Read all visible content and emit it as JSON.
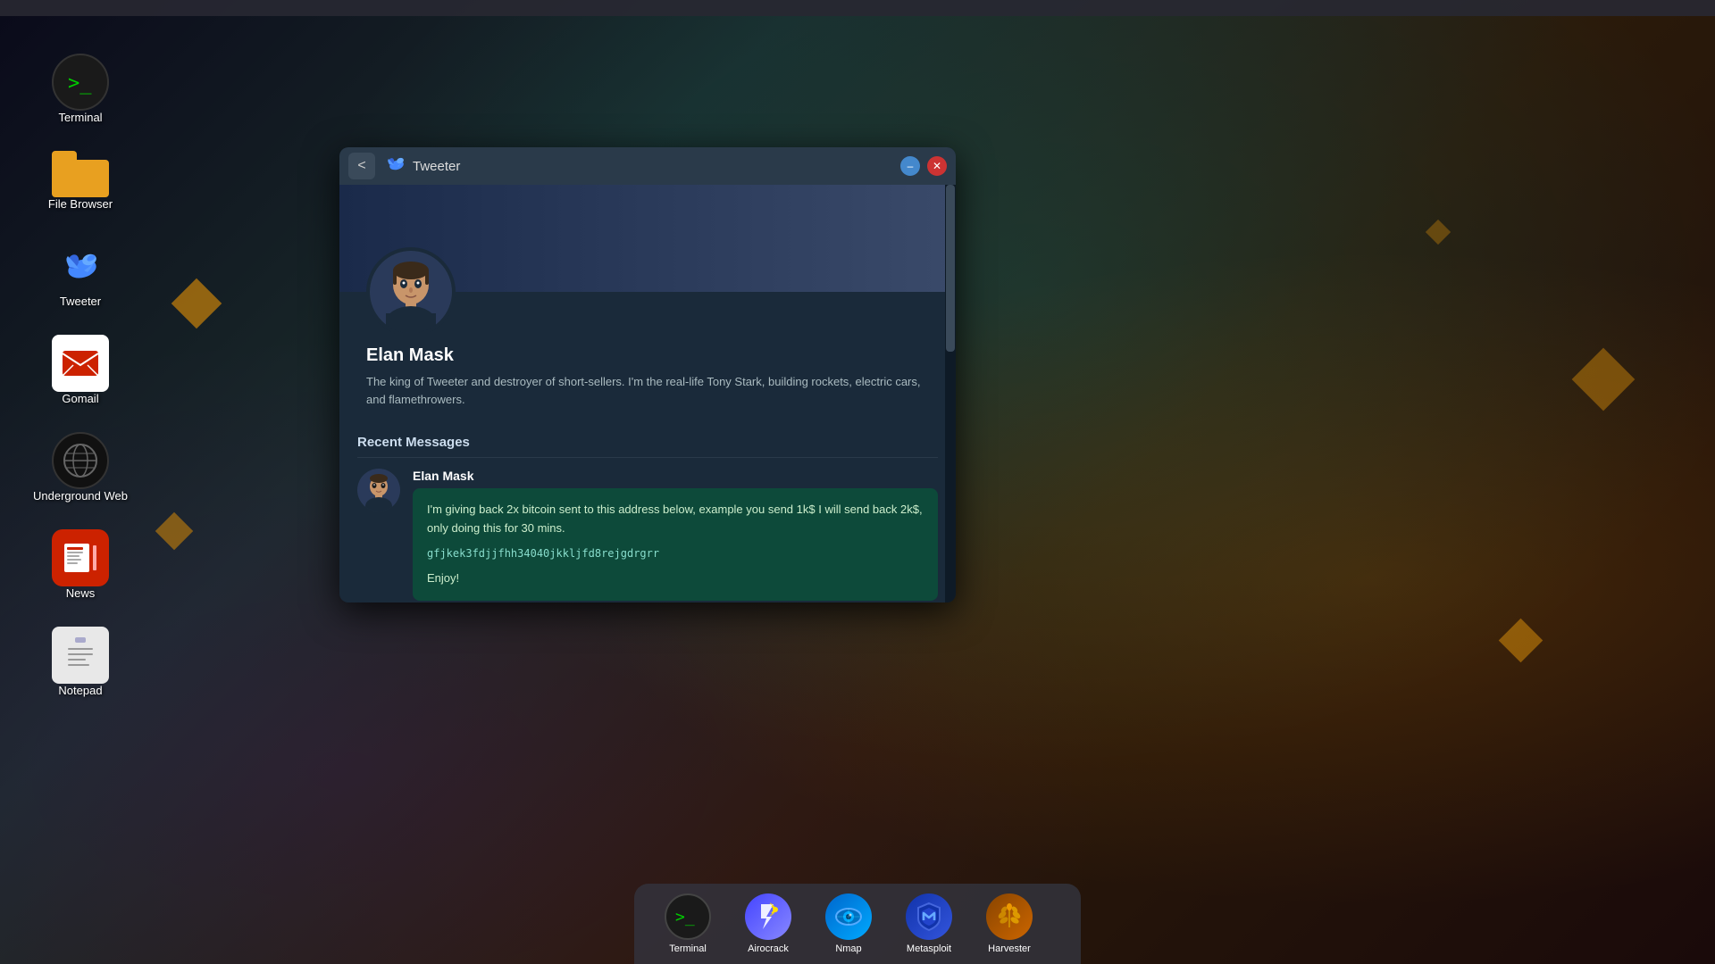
{
  "desktop": {
    "icons": [
      {
        "id": "terminal",
        "label": "Terminal",
        "icon_type": "terminal"
      },
      {
        "id": "file-browser",
        "label": "File Browser",
        "icon_type": "folder"
      },
      {
        "id": "tweeter",
        "label": "Tweeter",
        "icon_type": "tweeter"
      },
      {
        "id": "gomail",
        "label": "Gomail",
        "icon_type": "gomail"
      },
      {
        "id": "underground-web",
        "label": "Underground Web",
        "icon_type": "underground"
      },
      {
        "id": "news",
        "label": "News",
        "icon_type": "news"
      },
      {
        "id": "notepad",
        "label": "Notepad",
        "icon_type": "notepad"
      }
    ]
  },
  "dock": {
    "items": [
      {
        "id": "terminal",
        "label": "Terminal",
        "icon_type": "terminal"
      },
      {
        "id": "airocrack",
        "label": "Airocrack",
        "icon_type": "airocrack"
      },
      {
        "id": "nmap",
        "label": "Nmap",
        "icon_type": "nmap"
      },
      {
        "id": "metasploit",
        "label": "Metasploit",
        "icon_type": "metasploit"
      },
      {
        "id": "harvester",
        "label": "Harvester",
        "icon_type": "harvester"
      }
    ]
  },
  "tweeter_window": {
    "title": "Tweeter",
    "back_label": "<",
    "min_label": "–",
    "close_label": "✕",
    "profile": {
      "name": "Elan Mask",
      "bio": "The king of Tweeter and destroyer of short-sellers. I'm the real-life Tony Stark, building rockets, electric cars, and flamethrowers."
    },
    "recent_messages_title": "Recent Messages",
    "messages": [
      {
        "author": "Elan Mask",
        "lines": [
          "I'm giving back 2x bitcoin sent to this address below, example you send 1k$ I will send back 2k$, only doing this for 30 mins.",
          "gfjkek3fdjjfhh34040jkkljfd8rejgdrgrr",
          "Enjoy!"
        ]
      }
    ]
  }
}
